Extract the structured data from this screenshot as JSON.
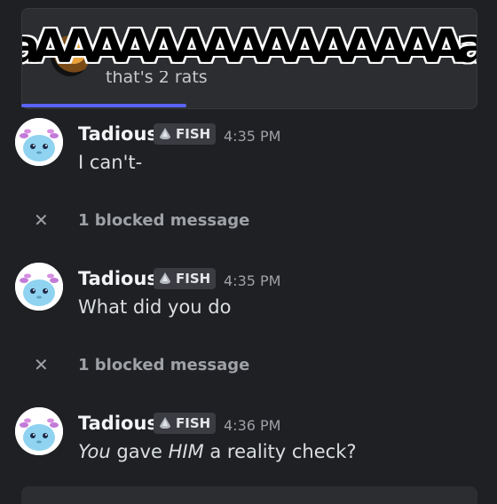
{
  "embed": {
    "meme_text": "aAAAAAAAAAAAAAAAa",
    "caption": "that's 2 rats"
  },
  "colors": {
    "accent": "#5865f2",
    "background": "#1f2023"
  },
  "messages": [
    {
      "username": "Tadious",
      "tag": "FISH",
      "time": "4:35 PM",
      "text": "I can't-"
    },
    {
      "username": "Tadious",
      "tag": "FISH",
      "time": "4:35 PM",
      "text": "What did you do"
    },
    {
      "username": "Tadious",
      "tag": "FISH",
      "time": "4:36 PM",
      "text_parts": [
        "You",
        " gave ",
        "HIM",
        " a reality check?"
      ]
    }
  ],
  "blocked": [
    {
      "label": "1 blocked message"
    },
    {
      "label": "1 blocked message"
    }
  ]
}
